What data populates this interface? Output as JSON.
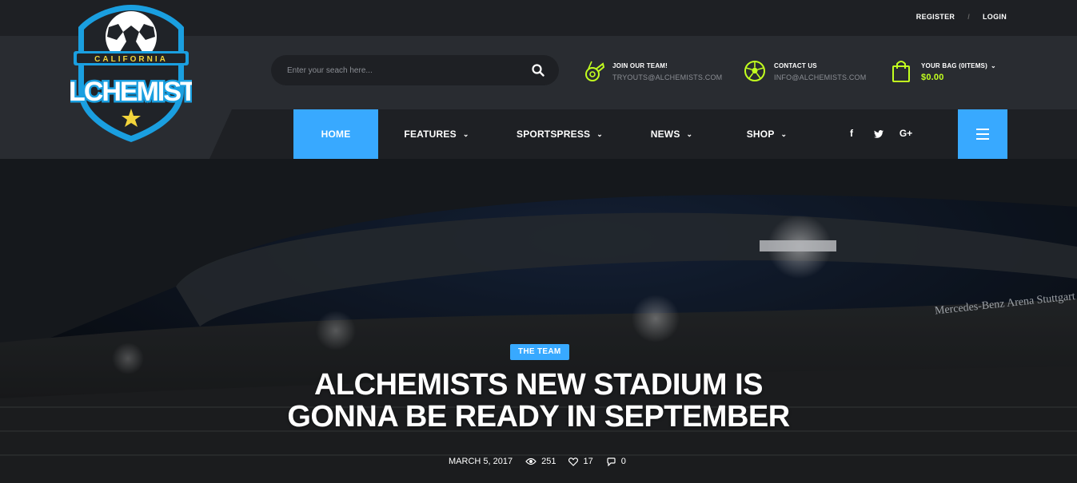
{
  "topbar": {
    "register": "REGISTER",
    "separator": "/",
    "login": "LOGIN"
  },
  "logo": {
    "top_text": "CALIFORNIA",
    "main_text": "ALCHEMISTS"
  },
  "search": {
    "placeholder": "Enter your seach here..."
  },
  "header_info": {
    "join": {
      "title": "JOIN OUR TEAM!",
      "subtitle": "TRYOUTS@ALCHEMISTS.COM"
    },
    "contact": {
      "title": "CONTACT US",
      "subtitle": "INFO@ALCHEMISTS.COM"
    },
    "bag": {
      "title": "YOUR BAG (0ITEMS)",
      "price": "$0.00"
    }
  },
  "menu": [
    {
      "label": "HOME",
      "active": true,
      "dropdown": false
    },
    {
      "label": "FEATURES",
      "active": false,
      "dropdown": true
    },
    {
      "label": "SPORTSPRESS",
      "active": false,
      "dropdown": true
    },
    {
      "label": "NEWS",
      "active": false,
      "dropdown": true
    },
    {
      "label": "SHOP",
      "active": false,
      "dropdown": true
    }
  ],
  "social": {
    "facebook": "f",
    "twitter": "twitter-icon",
    "google_plus": "G+"
  },
  "hero": {
    "category": "THE TEAM",
    "title_line1": "ALCHEMISTS NEW STADIUM IS",
    "title_line2": "GONNA BE READY IN SEPTEMBER",
    "date": "MARCH 5, 2017",
    "views": "251",
    "likes": "17",
    "comments": "0",
    "stadium_sign": "Mercedes-Benz Arena Stuttgart"
  },
  "colors": {
    "accent": "#38a9ff",
    "lime": "#c2ff1f",
    "dark": "#1e2024",
    "panel": "#292c31"
  }
}
